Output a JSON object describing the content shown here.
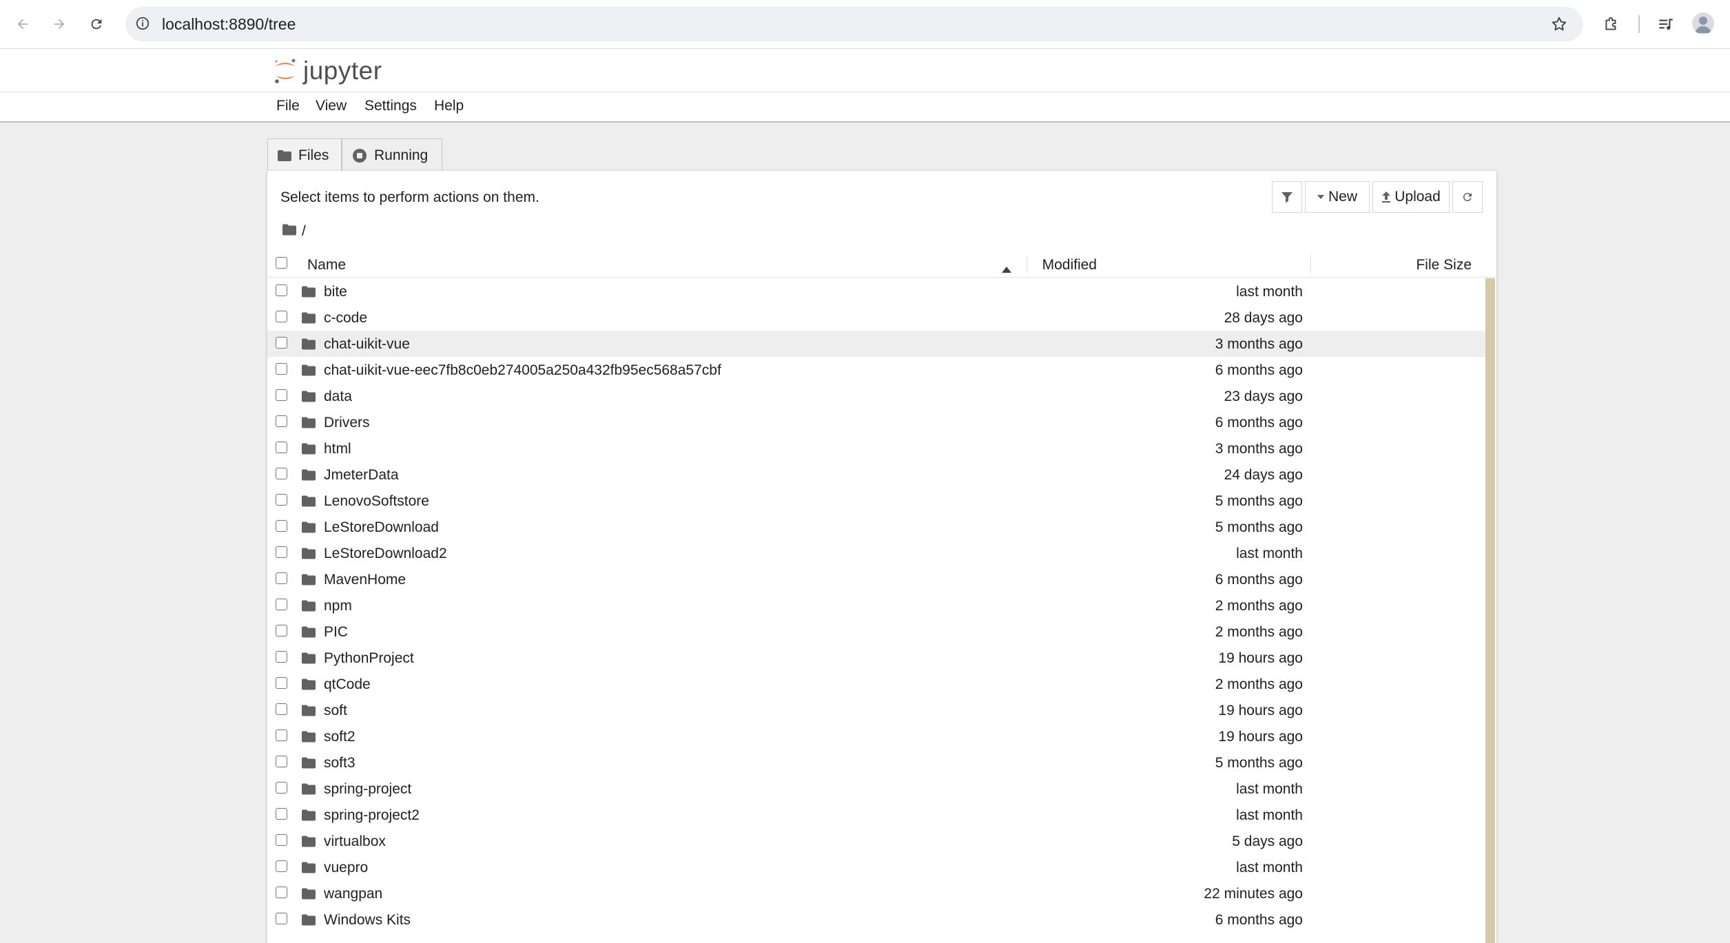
{
  "browser": {
    "url": "localhost:8890/tree"
  },
  "app": {
    "logo_text": "jupyter"
  },
  "menu": [
    "File",
    "View",
    "Settings",
    "Help"
  ],
  "tabs": [
    {
      "label": "Files",
      "active": true
    },
    {
      "label": "Running",
      "active": false
    }
  ],
  "panel": {
    "hint": "Select items to perform actions on them.",
    "breadcrumb": "/",
    "toolbar": {
      "new_label": "New",
      "upload_label": "Upload"
    }
  },
  "columns": {
    "name": "Name",
    "modified": "Modified",
    "file_size": "File Size"
  },
  "files": [
    {
      "name": "bite",
      "modified": "last month",
      "size": ""
    },
    {
      "name": "c-code",
      "modified": "28 days ago",
      "size": ""
    },
    {
      "name": "chat-uikit-vue",
      "modified": "3 months ago",
      "size": "",
      "highlighted": true
    },
    {
      "name": "chat-uikit-vue-eec7fb8c0eb274005a250a432fb95ec568a57cbf",
      "modified": "6 months ago",
      "size": ""
    },
    {
      "name": "data",
      "modified": "23 days ago",
      "size": ""
    },
    {
      "name": "Drivers",
      "modified": "6 months ago",
      "size": ""
    },
    {
      "name": "html",
      "modified": "3 months ago",
      "size": ""
    },
    {
      "name": "JmeterData",
      "modified": "24 days ago",
      "size": ""
    },
    {
      "name": "LenovoSoftstore",
      "modified": "5 months ago",
      "size": ""
    },
    {
      "name": "LeStoreDownload",
      "modified": "5 months ago",
      "size": ""
    },
    {
      "name": "LeStoreDownload2",
      "modified": "last month",
      "size": ""
    },
    {
      "name": "MavenHome",
      "modified": "6 months ago",
      "size": ""
    },
    {
      "name": "npm",
      "modified": "2 months ago",
      "size": ""
    },
    {
      "name": "PIC",
      "modified": "2 months ago",
      "size": ""
    },
    {
      "name": "PythonProject",
      "modified": "19 hours ago",
      "size": ""
    },
    {
      "name": "qtCode",
      "modified": "2 months ago",
      "size": ""
    },
    {
      "name": "soft",
      "modified": "19 hours ago",
      "size": ""
    },
    {
      "name": "soft2",
      "modified": "19 hours ago",
      "size": ""
    },
    {
      "name": "soft3",
      "modified": "5 months ago",
      "size": ""
    },
    {
      "name": "spring-project",
      "modified": "last month",
      "size": ""
    },
    {
      "name": "spring-project2",
      "modified": "last month",
      "size": ""
    },
    {
      "name": "virtualbox",
      "modified": "5 days ago",
      "size": ""
    },
    {
      "name": "vuepro",
      "modified": "last month",
      "size": ""
    },
    {
      "name": "wangpan",
      "modified": "22 minutes ago",
      "size": ""
    },
    {
      "name": "Windows Kits",
      "modified": "6 months ago",
      "size": ""
    }
  ],
  "colors": {
    "jupyter_orange": "#f37726",
    "scrollbar": "#d4c9a8",
    "row_highlight": "#eeeeee"
  }
}
